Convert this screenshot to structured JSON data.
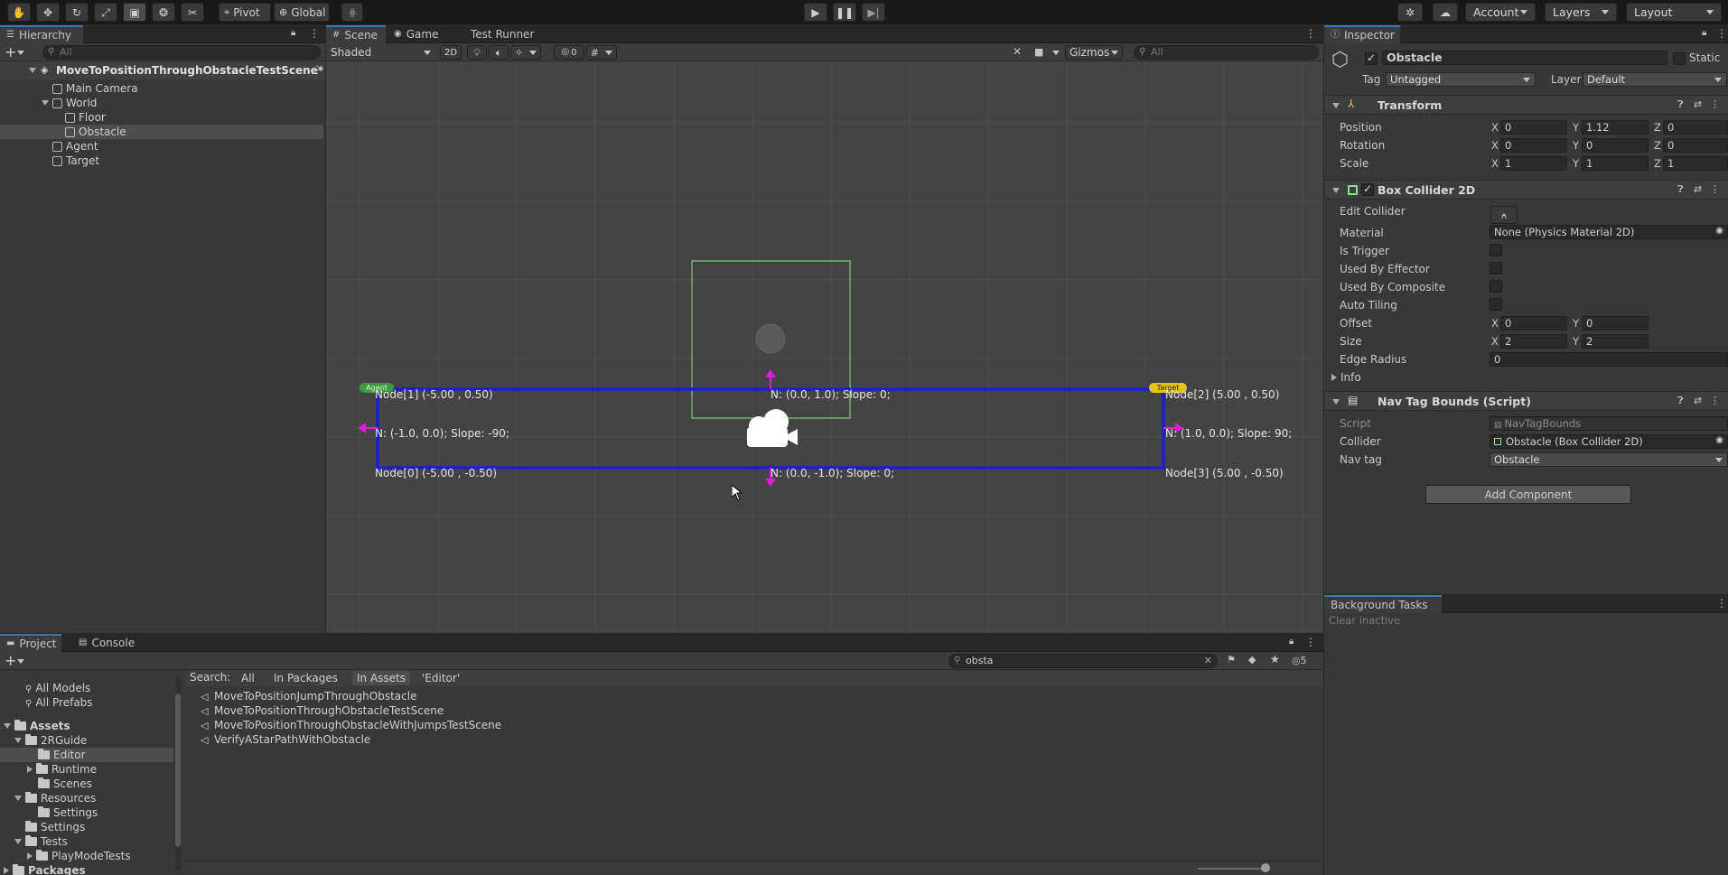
{
  "toolbar": {
    "tools": [
      "hand-tool-icon",
      "move-tool-icon",
      "rotate-tool-icon",
      "scale-tool-icon",
      "rect-tool-icon",
      "transform-tool-icon",
      "custom-tool-icon"
    ],
    "pivot_label": "Pivot",
    "global_label": "Global",
    "account_label": "Account",
    "layers_label": "Layers",
    "layout_label": "Layout"
  },
  "hierarchy": {
    "tab_label": "Hierarchy",
    "search_placeholder": "All",
    "scene_name": "MoveToPositionThroughObstacleTestScene*",
    "items": [
      {
        "label": "Main Camera"
      },
      {
        "label": "World"
      },
      {
        "label": "Floor"
      },
      {
        "label": "Obstacle"
      },
      {
        "label": "Agent"
      },
      {
        "label": "Target"
      }
    ]
  },
  "scene_view": {
    "tabs": [
      {
        "label": "Scene"
      },
      {
        "label": "Game"
      },
      {
        "label": "Test Runner"
      }
    ],
    "shading_mode": "Shaded",
    "toggle_2d": "2D",
    "hidden_count": "0",
    "gizmos_label": "Gizmos",
    "search_placeholder": "All",
    "agent_badge": "Agent",
    "target_badge": "Target",
    "labels": {
      "node1": "Node[1] (-5.00 , 0.50)",
      "node2": "Node[2] (5.00 , 0.50)",
      "node0": "Node[0] (-5.00 , -0.50)",
      "node3": "Node[3] (5.00 , -0.50)",
      "top_normal": "N: (0.0, 1.0); Slope: 0;",
      "left_normal": "N: (-1.0, 0.0); Slope: -90;",
      "right_normal": "N: (1.0, 0.0); Slope: 90;",
      "bottom_normal": "N: (0.0, -1.0); Slope: 0;"
    }
  },
  "inspector": {
    "tab_label": "Inspector",
    "object_name": "Obstacle",
    "static_label": "Static",
    "tag_label": "Tag",
    "tag_value": "Untagged",
    "layer_label": "Layer",
    "layer_value": "Default",
    "transform": {
      "title": "Transform",
      "position_label": "Position",
      "rotation_label": "Rotation",
      "scale_label": "Scale",
      "position": {
        "x": "0",
        "y": "1.12",
        "z": "0"
      },
      "rotation": {
        "x": "0",
        "y": "0",
        "z": "0"
      },
      "scale": {
        "x": "1",
        "y": "1",
        "z": "1"
      },
      "axis_x": "X",
      "axis_y": "Y",
      "axis_z": "Z"
    },
    "box_collider": {
      "title": "Box Collider 2D",
      "edit_collider_label": "Edit Collider",
      "material_label": "Material",
      "material_value": "None (Physics Material 2D)",
      "is_trigger_label": "Is Trigger",
      "used_by_effector_label": "Used By Effector",
      "used_by_composite_label": "Used By Composite",
      "auto_tiling_label": "Auto Tiling",
      "offset_label": "Offset",
      "offset": {
        "x": "0",
        "y": "0"
      },
      "size_label": "Size",
      "size": {
        "x": "2",
        "y": "2"
      },
      "edge_radius_label": "Edge Radius",
      "edge_radius_value": "0",
      "info_label": "Info"
    },
    "nav_tag_bounds": {
      "title": "Nav Tag Bounds (Script)",
      "script_label": "Script",
      "script_value": "NavTagBounds",
      "collider_label": "Collider",
      "collider_value": "Obstacle (Box Collider 2D)",
      "nav_tag_label": "Nav tag",
      "nav_tag_value": "Obstacle"
    },
    "add_component_label": "Add Component"
  },
  "background_tasks": {
    "tab_label": "Background Tasks",
    "clear_inactive_label": "Clear inactive"
  },
  "project": {
    "tabs": [
      {
        "label": "Project"
      },
      {
        "label": "Console"
      }
    ],
    "search_value": "obsta",
    "hidden_count": "5",
    "search_label": "Search:",
    "search_scopes": [
      {
        "label": "All"
      },
      {
        "label": "In Packages"
      },
      {
        "label": "In Assets"
      },
      {
        "label": "'Editor'"
      }
    ],
    "favorites": [
      {
        "label": "All Models"
      },
      {
        "label": "All Prefabs"
      }
    ],
    "tree": [
      {
        "label": "Assets"
      },
      {
        "label": "2RGuide"
      },
      {
        "label": "Editor"
      },
      {
        "label": "Runtime"
      },
      {
        "label": "Scenes"
      },
      {
        "label": "Resources"
      },
      {
        "label": "Settings"
      },
      {
        "label": "Settings"
      },
      {
        "label": "Tests"
      },
      {
        "label": "PlayModeTests"
      },
      {
        "label": "Packages"
      }
    ],
    "results": [
      {
        "label": "MoveToPositionJumpThroughObstacle"
      },
      {
        "label": "MoveToPositionThroughObstacleTestScene"
      },
      {
        "label": "MoveToPositionThroughObstacleWithJumpsTestScene"
      },
      {
        "label": "VerifyAStarPathWithObstacle"
      }
    ]
  },
  "colors": {
    "accent_blue": "#1c1cd8",
    "handle_magenta": "#e21ce2",
    "collider_green": "#8ee08e",
    "agent_badge": "#3d9a3d",
    "target_badge": "#e6c21b"
  }
}
